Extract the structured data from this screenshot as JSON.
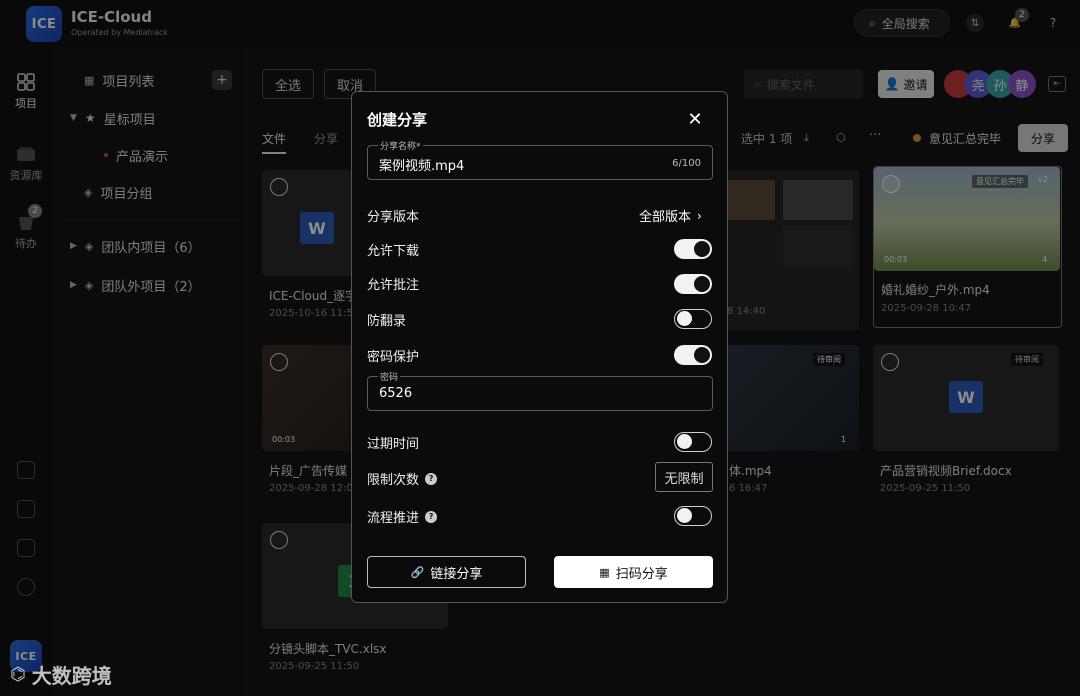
{
  "topbar": {
    "logo_text": "ICE",
    "app_title": "ICE-Cloud",
    "app_subtitle": "Operated by Mediatrack",
    "search_label": "全局搜索",
    "notification_count": "2",
    "help_label": "?"
  },
  "rail": {
    "items": [
      {
        "label": "项目"
      },
      {
        "label": "资源库"
      },
      {
        "label": "待办",
        "badge": "2"
      }
    ]
  },
  "tree": {
    "project_list": "项目列表",
    "starred": "星标项目",
    "starred_child": "产品演示",
    "groups": "项目分组",
    "team_in": "团队内项目（6）",
    "team_out": "团队外项目（2）"
  },
  "main": {
    "select_all": "全选",
    "cancel": "取消",
    "search_placeholder": "搜索文件",
    "invite": "邀请",
    "avatars": [
      "尧",
      "孙",
      "静"
    ],
    "tab_files": "文件",
    "tab_share": "分享",
    "selected_info": "选中 1 项",
    "status_text": "意见汇总完毕",
    "share_button": "分享",
    "cards": [
      {
        "name": "ICE-Cloud_逐字",
        "date": "2025-10-16 11:5"
      },
      {
        "name": "",
        "date": "8 14:40"
      },
      {
        "name": "婚礼婚纱_户外.mp4",
        "date": "2025-09-28 10:47",
        "duration": "00:03",
        "tag": "意见汇总完毕",
        "version": "v2",
        "comments": "4"
      },
      {
        "name": "片段_广告传媒",
        "date": "2025-09-28 12:0",
        "duration": "00:03"
      },
      {
        "name": "体.mp4",
        "date": "6 16:47",
        "tag": "待审阅",
        "comments": "1"
      },
      {
        "name": "产品营销视频Brief.docx",
        "date": "2025-09-25 11:50",
        "tag": "待审阅"
      },
      {
        "name": "分镜头脚本_TVC.xlsx",
        "date": "2025-09-25 11:50"
      }
    ]
  },
  "modal": {
    "title": "创建分享",
    "name_label": "分享名称*",
    "name_value": "案例视频.mp4",
    "name_count": "6/100",
    "version_label": "分享版本",
    "version_value": "全部版本",
    "allow_download": "允许下载",
    "allow_comment": "允许批注",
    "anti_record": "防翻录",
    "password_protect": "密码保护",
    "password_label": "密码",
    "password_value": "6526",
    "expire_time": "过期时间",
    "limit_count": "限制次数",
    "limit_value": "无限制",
    "workflow": "流程推进",
    "link_share": "链接分享",
    "qr_share": "扫码分享"
  },
  "watermark": "大数跨境"
}
